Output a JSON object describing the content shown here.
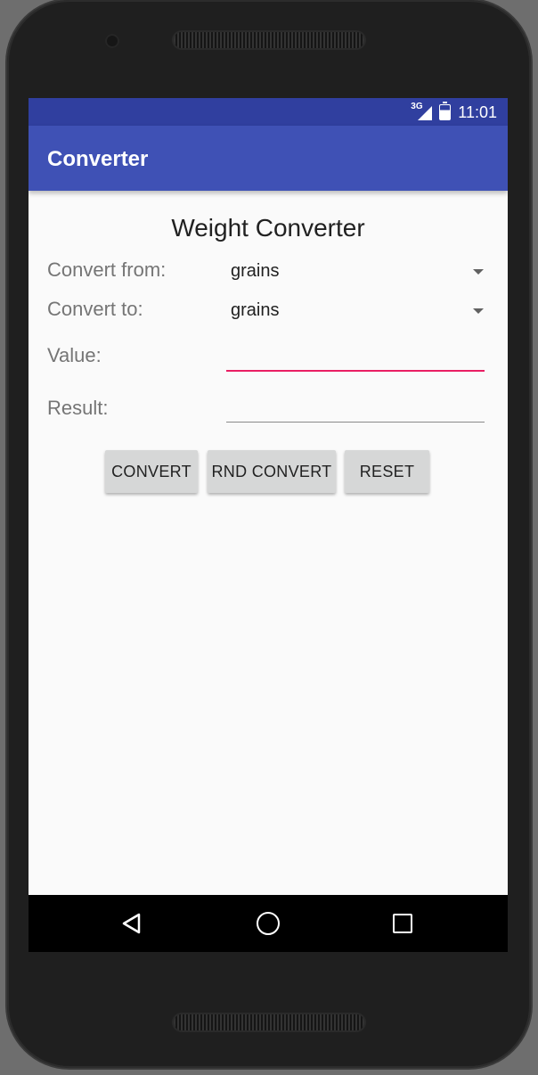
{
  "status_bar": {
    "network": "3G",
    "time": "11:01"
  },
  "app_bar": {
    "title": "Converter"
  },
  "form": {
    "heading": "Weight Converter",
    "convert_from": {
      "label": "Convert from:",
      "value": "grains"
    },
    "convert_to": {
      "label": "Convert to:",
      "value": "grains"
    },
    "value": {
      "label": "Value:",
      "input_value": ""
    },
    "result": {
      "label": "Result:",
      "output_value": ""
    }
  },
  "buttons": {
    "convert": "CONVERT",
    "rnd_convert": "RND CONVERT",
    "reset": "RESET"
  },
  "navigation": {
    "back_icon": "back-triangle-icon",
    "home_icon": "home-circle-icon",
    "recents_icon": "recents-square-icon"
  },
  "colors": {
    "status_bar": "#303f9f",
    "app_bar": "#3f51b5",
    "background": "#fafafa",
    "accent": "#e91e63",
    "button": "#d6d7d7"
  }
}
